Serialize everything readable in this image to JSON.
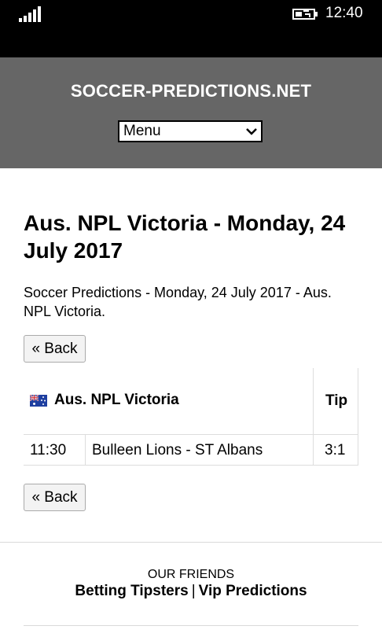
{
  "status_bar": {
    "time": "12:40",
    "signal_icon": "signal-bars-icon",
    "battery_icon": "battery-charging-icon"
  },
  "header": {
    "site_title": "SOCCER-PREDICTIONS.NET",
    "menu_selected": "Menu",
    "menu_icon": "chevron-down-icon",
    "background": "#666666"
  },
  "main": {
    "title": "Aus. NPL Victoria - Monday, 24 July 2017",
    "description": "Soccer Predictions - Monday, 24 July 2017 - Aus. NPL Victoria.",
    "back_label": "« Back",
    "table": {
      "competition": "Aus. NPL Victoria",
      "flag_icon": "australia-flag-icon",
      "tip_header": "Tip",
      "rows": [
        {
          "time": "11:30",
          "match": "Bulleen Lions - ST Albans",
          "tip": "3:1"
        }
      ]
    }
  },
  "footer": {
    "friends_label": "OUR FRIENDS",
    "links": [
      "Betting Tipsters",
      "Vip Predictions"
    ],
    "separator": "|"
  }
}
